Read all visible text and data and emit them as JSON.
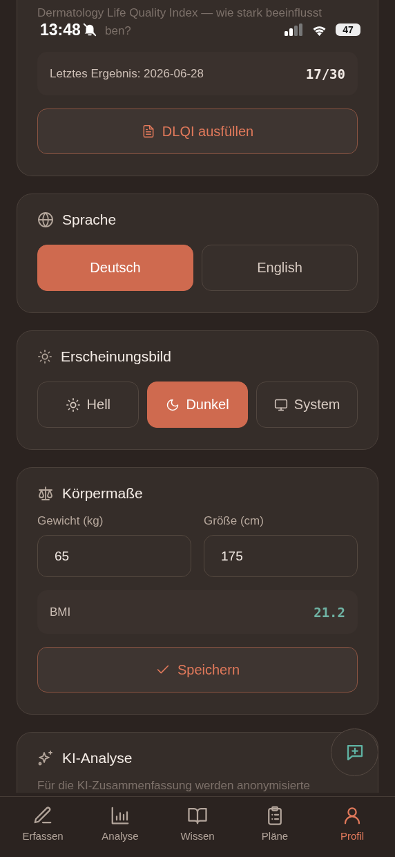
{
  "status_bar": {
    "time": "13:48",
    "muted": true,
    "battery": "47"
  },
  "dlqi_card": {
    "description": "Dermatology Life Quality Index — wie stark beeinflusst",
    "description_fragment": "ben?",
    "last_result": "Letztes Ergebnis: 2026-06-28",
    "score": "17/30",
    "button": "DLQI ausfüllen"
  },
  "language_card": {
    "title": "Sprache",
    "options": [
      {
        "label": "Deutsch",
        "selected": true
      },
      {
        "label": "English",
        "selected": false
      }
    ]
  },
  "appearance_card": {
    "title": "Erscheinungsbild",
    "options": [
      {
        "label": "Hell",
        "kind": "light",
        "selected": false
      },
      {
        "label": "Dunkel",
        "kind": "dark",
        "selected": true
      },
      {
        "label": "System",
        "kind": "system",
        "selected": false
      }
    ]
  },
  "body_card": {
    "title": "Körpermaße",
    "fields": [
      {
        "label": "Gewicht (kg)",
        "value": "65"
      },
      {
        "label": "Größe (cm)",
        "value": "175"
      }
    ],
    "bmi_label": "BMI",
    "bmi_value": "21.2",
    "button": "Speichern"
  },
  "ai_card": {
    "title": "KI-Analyse",
    "text": "Für die KI-Zusammenfassung werden anonymisierte"
  },
  "tabs": [
    {
      "label": "Erfassen",
      "kind": "pen",
      "selected": false
    },
    {
      "label": "Analyse",
      "kind": "chart",
      "selected": false
    },
    {
      "label": "Wissen",
      "kind": "book",
      "selected": false
    },
    {
      "label": "Pläne",
      "kind": "clipboard",
      "selected": false
    },
    {
      "label": "Profil",
      "kind": "user",
      "selected": true
    }
  ]
}
